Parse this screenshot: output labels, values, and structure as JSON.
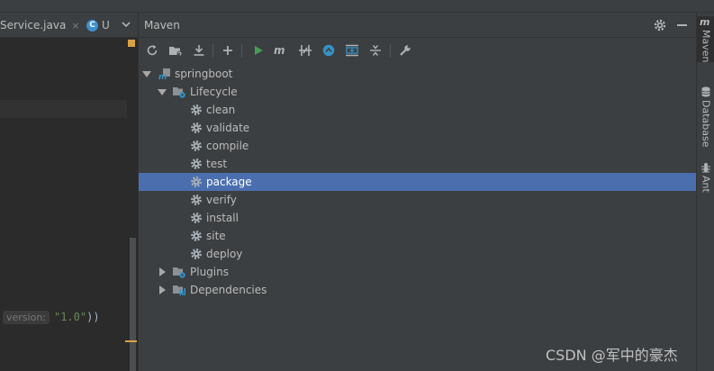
{
  "editor": {
    "tab_active": "Service.java",
    "tab_active_close": "×",
    "tab_second_badge": "C",
    "tab_second": "U",
    "code": {
      "param_hint": "version:",
      "string_value": "\"1.0\"",
      "closing": "))"
    }
  },
  "maven": {
    "title": "Maven",
    "toolbar": [
      {
        "name": "reload-icon",
        "tooltip": "Reimport All Maven Projects"
      },
      {
        "name": "folder-generate-icon",
        "tooltip": "Generate Sources"
      },
      {
        "name": "download-icon",
        "tooltip": "Download Sources"
      },
      {
        "name": "add-icon",
        "tooltip": "Add Maven Projects"
      },
      {
        "name": "run-icon",
        "tooltip": "Run Maven Build"
      },
      {
        "name": "maven-goal-icon",
        "tooltip": "Execute Maven Goal"
      },
      {
        "name": "skip-tests-icon",
        "tooltip": "Toggle Skip Tests"
      },
      {
        "name": "offline-icon",
        "tooltip": "Toggle Offline Mode"
      },
      {
        "name": "show-dependencies-icon",
        "tooltip": "Show Dependencies"
      },
      {
        "name": "collapse-all-icon",
        "tooltip": "Collapse All"
      },
      {
        "name": "settings-wrench-icon",
        "tooltip": "Maven Settings"
      }
    ],
    "tree": {
      "project": "springboot",
      "lifecycle": {
        "label": "Lifecycle",
        "goals": [
          "clean",
          "validate",
          "compile",
          "test",
          "package",
          "verify",
          "install",
          "site",
          "deploy"
        ],
        "selected": "package"
      },
      "plugins": "Plugins",
      "dependencies": "Dependencies"
    }
  },
  "right_strip": {
    "tabs": [
      {
        "label": "Maven",
        "icon": "maven-m-icon",
        "active": true
      },
      {
        "label": "Database",
        "icon": "database-icon",
        "active": false
      },
      {
        "label": "Ant",
        "icon": "ant-icon",
        "active": false
      }
    ]
  },
  "watermark": "CSDN @军中的豪杰",
  "colors": {
    "selection": "#4b6eaf",
    "run_green": "#499c54",
    "badge_blue": "#3d8fd1",
    "warning": "#d9a343"
  }
}
